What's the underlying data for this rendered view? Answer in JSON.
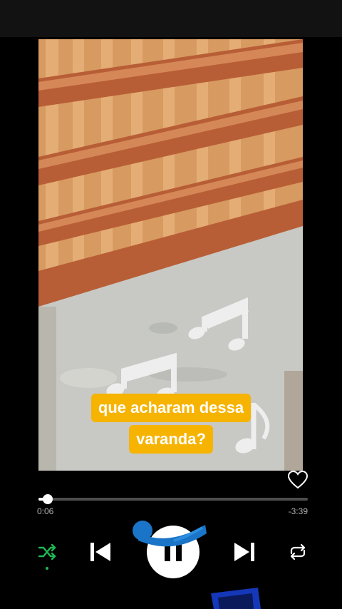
{
  "video": {
    "caption_lines": [
      "que acharam dessa",
      "varanda?"
    ]
  },
  "player": {
    "liked": false,
    "progress_fraction": 0.035,
    "elapsed": "0:06",
    "remaining": "-3:39",
    "shuffle_active": true
  },
  "icons": {
    "heart": "heart-icon",
    "shuffle": "shuffle-icon",
    "previous": "skip-previous-icon",
    "pause": "pause-icon",
    "next": "skip-next-icon",
    "repeat": "repeat-icon"
  },
  "colors": {
    "accent_green": "#1db954",
    "caption_bg": "#f6b300"
  }
}
